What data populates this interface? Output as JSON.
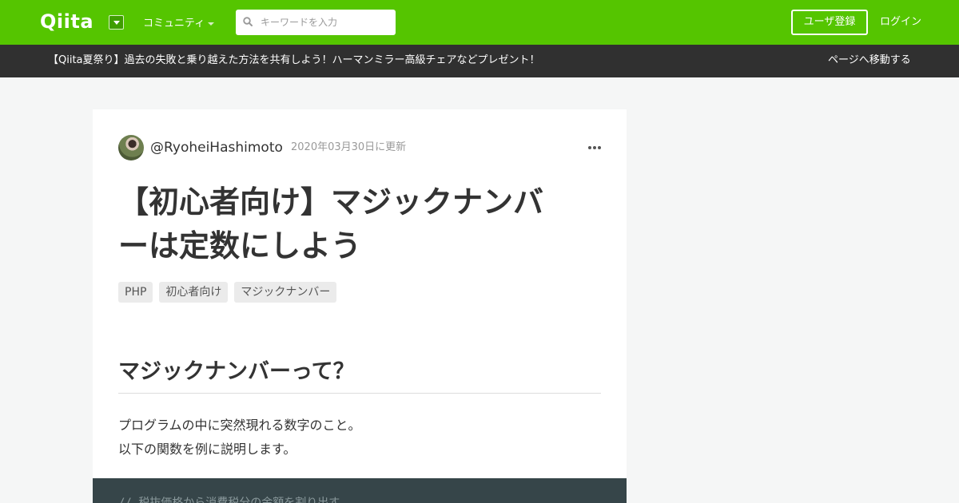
{
  "header": {
    "logo": "Qiita",
    "community_label": "コミュニティ",
    "search_placeholder": "キーワードを入力",
    "signup_label": "ユーザ登録",
    "login_label": "ログイン",
    "brand_color": "#55c500"
  },
  "announcement": {
    "text": "【Qiita夏祭り】過去の失敗と乗り越えた方法を共有しよう！ハーマンミラー高級チェアなどプレゼント！",
    "link_label": "ページへ移動する"
  },
  "article": {
    "author": "@RyoheiHashimoto",
    "updated": "2020年03月30日に更新",
    "title_line1": "【初心者向け】マジックナンバ",
    "title_line2": "ーは定数にしよう",
    "tags": [
      "PHP",
      "初心者向け",
      "マジックナンバー"
    ],
    "heading": "マジックナンバーって？",
    "paragraph_line1": "プログラムの中に突然現れる数字のこと。",
    "paragraph_line2": "以下の関数を例に説明します。",
    "code_first_line": "// 税抜価格から消費税分の金額を割り出す"
  },
  "icons": {
    "search": "search-icon",
    "dropdown": "chevron-down-icon",
    "more": "more-horizontal-icon"
  }
}
